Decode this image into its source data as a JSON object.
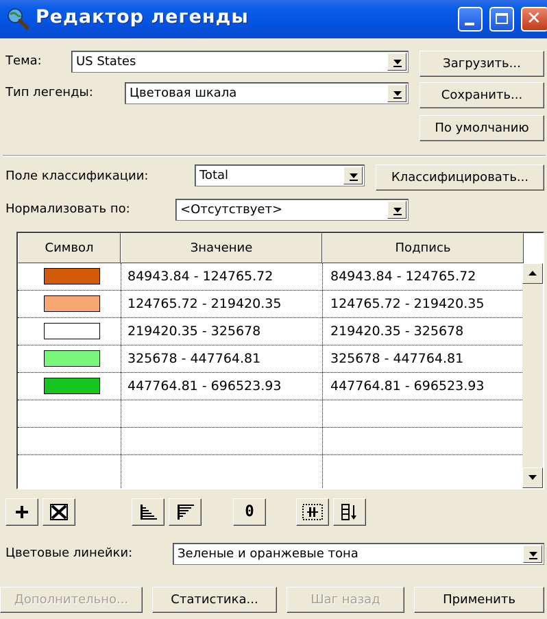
{
  "window": {
    "title": "Редактор легенды"
  },
  "theme": {
    "label": "Тема:",
    "value": "US States"
  },
  "legend_type": {
    "label": "Тип легенды:",
    "value": "Цветовая шкала"
  },
  "buttons": {
    "load": "Загрузить...",
    "save": "Сохранить...",
    "default": "По умолчанию",
    "classify": "Классифицировать...",
    "advanced": "Дополнительно...",
    "statistics": "Статистика...",
    "undo": "Шаг назад",
    "apply": "Применить"
  },
  "classification_field": {
    "label": "Поле классификации:",
    "value": "Total"
  },
  "normalize": {
    "label": "Нормализовать по:",
    "value": "<Отсутствует>"
  },
  "table": {
    "columns": [
      "Символ",
      "Значение",
      "Подпись"
    ],
    "rows": [
      {
        "color": "#d35a0a",
        "value": "84943.84 - 124765.72",
        "label": "84943.84 - 124765.72"
      },
      {
        "color": "#f7a772",
        "value": "124765.72 - 219420.35",
        "label": "124765.72 - 219420.35"
      },
      {
        "color": "#ffffff",
        "value": "219420.35 - 325678",
        "label": "219420.35 - 325678"
      },
      {
        "color": "#78f77a",
        "value": "325678 - 447764.81",
        "label": "325678 - 447764.81"
      },
      {
        "color": "#18c41f",
        "value": "447764.81 - 696523.93",
        "label": "447764.81 - 696523.93"
      }
    ]
  },
  "toolbar": {
    "icons": [
      "add-icon",
      "delete-icon",
      "sort-ascending-icon",
      "sort-descending-icon",
      "zero-icon",
      "reverse-icon",
      "sort-icon"
    ],
    "zero_text": "0"
  },
  "color_ramp": {
    "label": "Цветовые линейки:",
    "value": "Зеленые и оранжевые тона"
  }
}
